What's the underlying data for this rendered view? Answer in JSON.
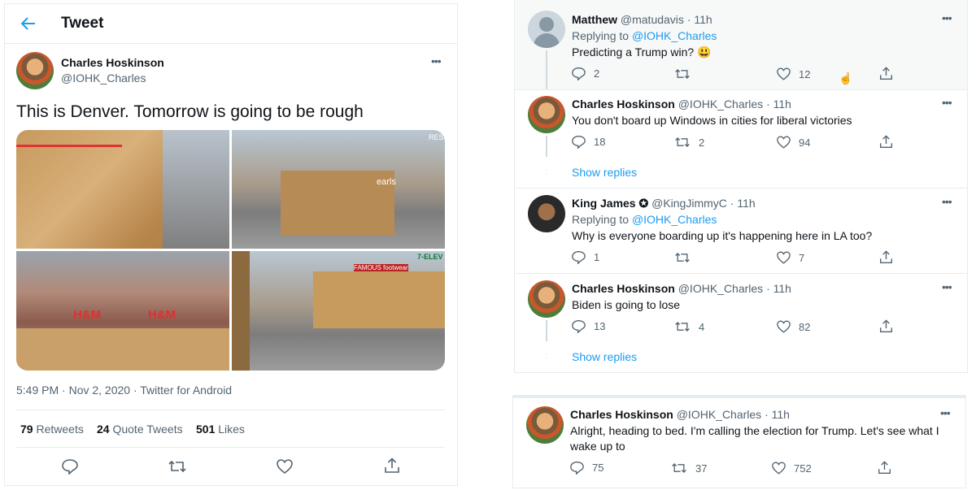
{
  "left": {
    "header_title": "Tweet",
    "author_name": "Charles Hoskinson",
    "author_handle": "@IOHK_Charles",
    "tweet_text": "This is Denver. Tomorrow is going to be rough",
    "meta": "5:49 PM · Nov 2, 2020 · Twitter for Android",
    "stats": {
      "retweets_count": "79",
      "retweets_label": "Retweets",
      "quotes_count": "24",
      "quotes_label": "Quote Tweets",
      "likes_count": "501",
      "likes_label": "Likes"
    },
    "image_text": {
      "earls": "earls",
      "hm1": "H&M",
      "hm2": "H&M",
      "famous": "FAMOUS footwear",
      "eleven": "7-ELEV",
      "resid": "RESID"
    }
  },
  "replies": [
    {
      "name": "Matthew",
      "handle": "@matudavis",
      "time": "· 11h",
      "replying_prefix": "Replying to",
      "replying_to": "@IOHK_Charles",
      "text": "Predicting a Trump win? 😃",
      "replies": "2",
      "retweets": "",
      "likes": "12"
    },
    {
      "name": "Charles Hoskinson",
      "handle": "@IOHK_Charles",
      "time": "· 11h",
      "text": "You don't board up Windows in cities for liberal victories",
      "replies": "18",
      "retweets": "2",
      "likes": "94",
      "show_replies": "Show replies"
    },
    {
      "name": "King James ✪",
      "handle": "@KingJimmyC",
      "time": "· 11h",
      "replying_prefix": "Replying to",
      "replying_to": "@IOHK_Charles",
      "text": "Why is everyone boarding up it's happening here in LA too?",
      "replies": "1",
      "retweets": "",
      "likes": "7"
    },
    {
      "name": "Charles Hoskinson",
      "handle": "@IOHK_Charles",
      "time": "· 11h",
      "text": "Biden is going to lose",
      "replies": "13",
      "retweets": "4",
      "likes": "82",
      "show_replies": "Show replies"
    },
    {
      "name": "Charles Hoskinson",
      "handle": "@IOHK_Charles",
      "time": "· 11h",
      "text_line1": "Alright, heading to bed. I'm calling the election for Trump. Let's see what I",
      "text_line2": "wake up to",
      "replies": "75",
      "retweets": "37",
      "likes": "752"
    }
  ],
  "colors": {
    "accent": "#1d9bf0",
    "muted": "#536471",
    "border": "#e6ecf0"
  }
}
